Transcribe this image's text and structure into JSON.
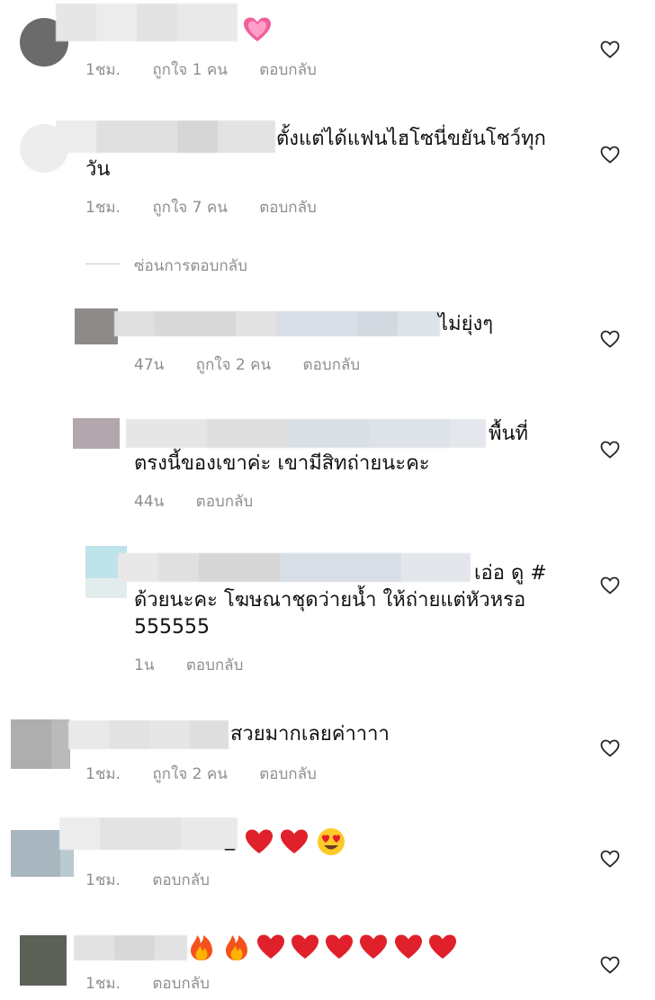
{
  "comments": [
    {
      "text": "",
      "emoji": "pink-heart",
      "time": "1ชม.",
      "likes": "ถูกใจ 1 คน",
      "reply": "ตอบกลับ"
    },
    {
      "text_line1": "ตั้งแต่ได้แฟนไฮโซนี่ขยันโชว์ทุก",
      "text_line2": "วัน",
      "time": "1ชม.",
      "likes": "ถูกใจ 7 คน",
      "reply": "ตอบกลับ"
    },
    {
      "hide_replies": "ซ่อนการตอบกลับ"
    },
    {
      "text": "ไม่ยุ่งๆ",
      "time": "47น",
      "likes": "ถูกใจ 2 คน",
      "reply": "ตอบกลับ"
    },
    {
      "text_line1": "พื้นที่",
      "text_line2": "ตรงนี้ของเขาค่ะ เขามีสิทถ่ายนะคะ",
      "time": "44น",
      "reply": "ตอบกลับ"
    },
    {
      "text_line1": "เอ่อ ดู #",
      "text_line2": "ด้วยนะคะ โฆษณาชุดว่ายน้ำ ให้ถ่ายแต่หัวหรอ",
      "text_line3": "555555",
      "time": "1น",
      "reply": "ตอบกลับ"
    },
    {
      "text": "สวยมากเลยค่าาาา",
      "time": "1ชม.",
      "likes": "ถูกใจ 2 คน",
      "reply": "ตอบกลับ"
    },
    {
      "prefix": "_",
      "emojis": [
        "red-heart",
        "red-heart",
        "heart-eyes"
      ],
      "time": "1ชม.",
      "reply": "ตอบกลับ"
    },
    {
      "emojis": [
        "fire",
        "fire",
        "red-heart",
        "red-heart",
        "red-heart",
        "red-heart",
        "red-heart",
        "red-heart"
      ],
      "time": "1ชม.",
      "reply": "ตอบกลับ"
    }
  ],
  "icons": {
    "like": "heart-outline-icon"
  },
  "colors": {
    "meta_text": "#8e8e8e",
    "heart_outline": "#262626",
    "red_heart": "#e0202a",
    "pink_heart": "#f0609c"
  }
}
